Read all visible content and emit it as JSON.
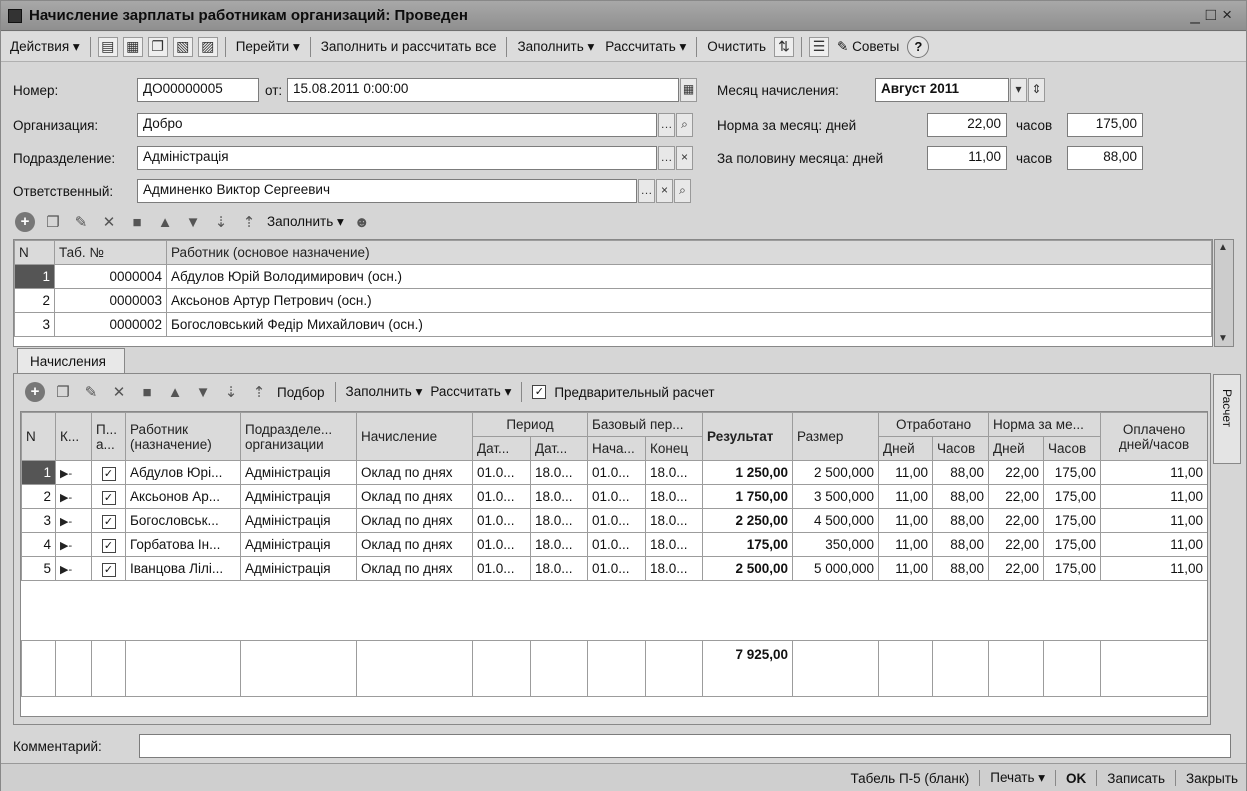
{
  "window": {
    "title": "Начисление зарплаты работникам организаций: Проведен"
  },
  "toolbar": {
    "actions": "Действия",
    "goto": "Перейти",
    "fill_calc_all": "Заполнить и рассчитать все",
    "fill": "Заполнить",
    "calculate": "Рассчитать",
    "clear": "Очистить",
    "tips": "Советы"
  },
  "header": {
    "number_label": "Номер:",
    "number_value": "ДО00000005",
    "from_label": "от:",
    "date_value": "15.08.2011  0:00:00",
    "org_label": "Организация:",
    "org_value": "Добро",
    "dept_label": "Подразделение:",
    "dept_value": "Адміністрація",
    "resp_label": "Ответственный:",
    "resp_value": "Админенко Виктор Сергеевич",
    "month_label": "Месяц начисления:",
    "month_value": "Август 2011",
    "norm_label": "Норма за месяц: дней",
    "norm_days": "22,00",
    "hours_label": "часов",
    "norm_hours": "175,00",
    "half_label": "За половину месяца: дней",
    "half_days": "11,00",
    "half_hours": "88,00"
  },
  "emp_toolbar": {
    "fill": "Заполнить"
  },
  "employees": {
    "headers": {
      "n": "N",
      "tab": "Таб. №",
      "worker": "Работник (основое назначение)"
    },
    "rows": [
      {
        "n": "1",
        "tab": "0000004",
        "name": "Абдулов Юрій Володимирович (осн.)"
      },
      {
        "n": "2",
        "tab": "0000003",
        "name": "Аксьонов Артур Петрович (осн.)"
      },
      {
        "n": "3",
        "tab": "0000002",
        "name": "Богословський Федір Михайлович (осн.)"
      }
    ]
  },
  "tabs": {
    "accruals": "Начисления",
    "side": "Расчет"
  },
  "calc_toolbar": {
    "select": "Подбор",
    "fill": "Заполнить",
    "calculate": "Рассчитать",
    "preliminary": "Предварительный расчет"
  },
  "calc": {
    "headers": {
      "n": "N",
      "k": "К...",
      "p1": "П...",
      "p2": "а...",
      "worker1": "Работник",
      "worker2": "(назначение)",
      "dept1": "Подразделе...",
      "dept2": "организации",
      "accrual": "Начисление",
      "period": "Период",
      "p_from": "Дат...",
      "p_to": "Дат...",
      "base": "Базовый пер...",
      "b_from": "Нача...",
      "b_to": "Конец",
      "result": "Результат",
      "size": "Размер",
      "worked": "Отработано",
      "w_days": "Дней",
      "w_hours": "Часов",
      "norm": "Норма за ме...",
      "n_days": "Дней",
      "n_hours": "Часов",
      "paid1": "Оплачено",
      "paid2": "дней/часов"
    },
    "rows": [
      {
        "n": "1",
        "worker": "Абдулов Юрі...",
        "dept": "Адміністрація",
        "accrual": "Оклад по днях",
        "pf": "01.0...",
        "pt": "18.0...",
        "bf": "01.0...",
        "bt": "18.0...",
        "result": "1 250,00",
        "size": "2 500,000",
        "wd": "11,00",
        "wh": "88,00",
        "nd": "22,00",
        "nh": "175,00",
        "paid": "11,00"
      },
      {
        "n": "2",
        "worker": "Аксьонов Ар...",
        "dept": "Адміністрація",
        "accrual": "Оклад по днях",
        "pf": "01.0...",
        "pt": "18.0...",
        "bf": "01.0...",
        "bt": "18.0...",
        "result": "1 750,00",
        "size": "3 500,000",
        "wd": "11,00",
        "wh": "88,00",
        "nd": "22,00",
        "nh": "175,00",
        "paid": "11,00"
      },
      {
        "n": "3",
        "worker": "Богословськ...",
        "dept": "Адміністрація",
        "accrual": "Оклад по днях",
        "pf": "01.0...",
        "pt": "18.0...",
        "bf": "01.0...",
        "bt": "18.0...",
        "result": "2 250,00",
        "size": "4 500,000",
        "wd": "11,00",
        "wh": "88,00",
        "nd": "22,00",
        "nh": "175,00",
        "paid": "11,00"
      },
      {
        "n": "4",
        "worker": "Горбатова Ін...",
        "dept": "Адміністрація",
        "accrual": "Оклад по днях",
        "pf": "01.0...",
        "pt": "18.0...",
        "bf": "01.0...",
        "bt": "18.0...",
        "result": "175,00",
        "size": "350,000",
        "wd": "11,00",
        "wh": "88,00",
        "nd": "22,00",
        "nh": "175,00",
        "paid": "11,00"
      },
      {
        "n": "5",
        "worker": "Іванцова Лілі...",
        "dept": "Адміністрація",
        "accrual": "Оклад по днях",
        "pf": "01.0...",
        "pt": "18.0...",
        "bf": "01.0...",
        "bt": "18.0...",
        "result": "2 500,00",
        "size": "5 000,000",
        "wd": "11,00",
        "wh": "88,00",
        "nd": "22,00",
        "nh": "175,00",
        "paid": "11,00"
      }
    ],
    "total": "7 925,00"
  },
  "comment_label": "Комментарий:",
  "footer": {
    "tabel": "Табель П-5 (бланк)",
    "print": "Печать",
    "ok": "OK",
    "save": "Записать",
    "close": "Закрыть"
  }
}
